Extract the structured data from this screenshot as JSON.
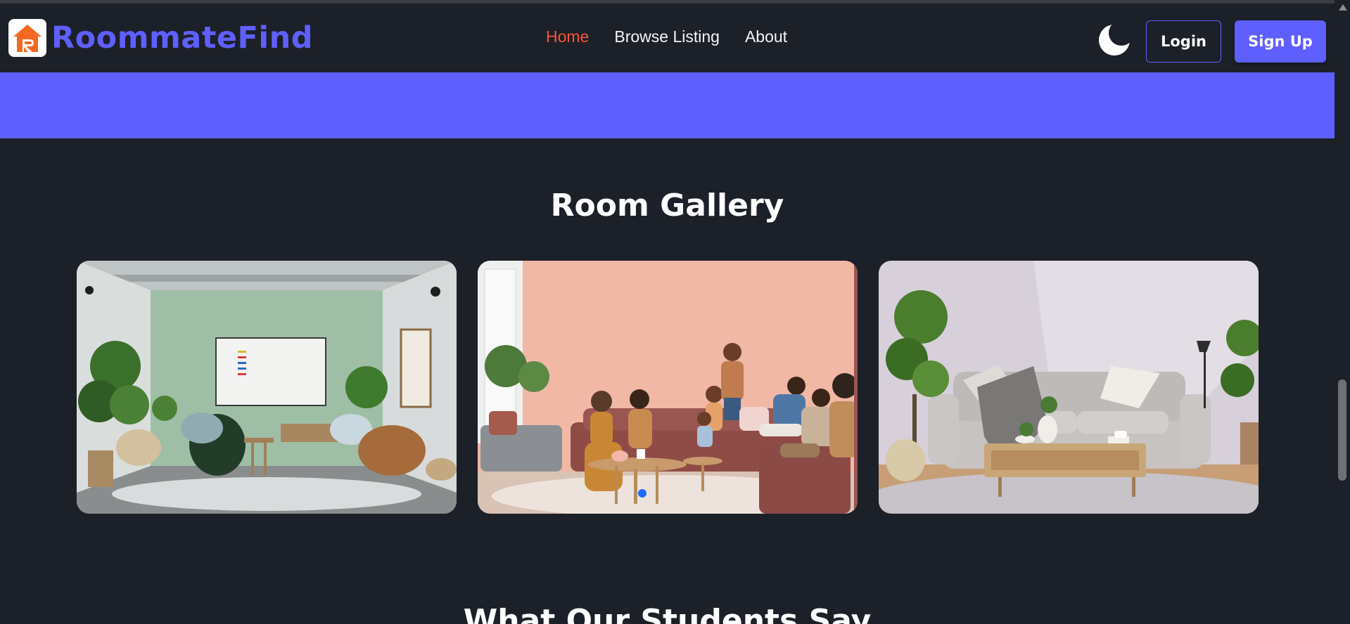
{
  "brand": {
    "name": "RoommateFind",
    "color": "#5f5fff",
    "logo_icon": "house-r-icon"
  },
  "nav": {
    "links": [
      {
        "label": "Home",
        "active": true
      },
      {
        "label": "Browse Listing",
        "active": false
      },
      {
        "label": "About",
        "active": false
      }
    ],
    "active_color": "#f2563c"
  },
  "actions": {
    "theme_toggle_icon": "moon-icon",
    "login_label": "Login",
    "signup_label": "Sign Up"
  },
  "gallery": {
    "title": "Room Gallery",
    "images": [
      {
        "description_icon": "image-green-lounge"
      },
      {
        "description_icon": "image-pink-living-room-people"
      },
      {
        "description_icon": "image-lavender-living-room"
      }
    ]
  },
  "next_section": {
    "title": "What Our Students Say"
  }
}
